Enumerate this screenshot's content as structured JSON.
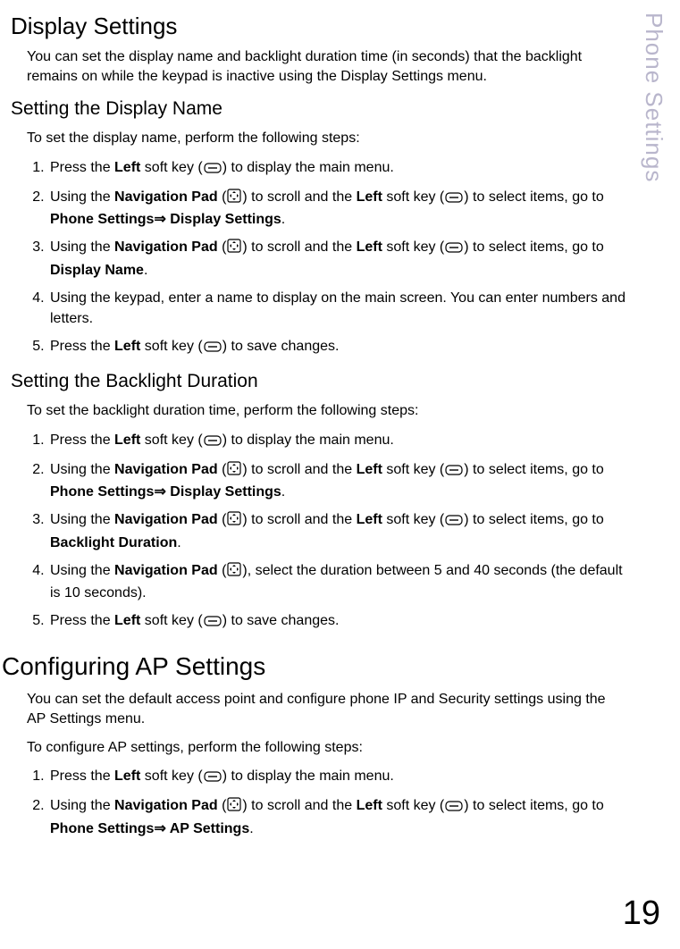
{
  "sideLabel": "Phone Settings",
  "pageNumber": "19",
  "arrow": "⇒",
  "displaySettings": {
    "heading": "Display Settings",
    "intro": "You can set the display name and backlight duration time (in seconds) that the backlight remains on while the keypad is inactive using the Display Settings menu."
  },
  "setDisplayName": {
    "heading": "Setting the Display Name",
    "intro": "To set the display name, perform the following steps:",
    "s1_a": "Press the ",
    "s1_b": "Left",
    "s1_c": " soft key (",
    "s1_d": ") to display the main menu.",
    "s2_a": "Using the ",
    "s2_b": "Navigation Pad",
    "s2_c": " (",
    "s2_d": ") to scroll and the ",
    "s2_e": "Left",
    "s2_f": " soft key (",
    "s2_g": ") to select items, go to ",
    "s2_h": "Phone Settings",
    "s2_i": " Display Settings",
    "s2_j": ".",
    "s3_a": "Using the ",
    "s3_b": "Navigation Pad",
    "s3_c": " (",
    "s3_d": ") to scroll and the ",
    "s3_e": "Left",
    "s3_f": " soft key (",
    "s3_g": ") to select items, go to ",
    "s3_h": "Display Name",
    "s3_i": ".",
    "s4": "Using the keypad, enter a name to display on the main screen. You can enter numbers and letters.",
    "s5_a": "Press the ",
    "s5_b": "Left",
    "s5_c": " soft key (",
    "s5_d": ") to save changes."
  },
  "setBacklight": {
    "heading": "Setting the Backlight Duration",
    "intro": "To set the backlight duration time, perform the following steps:",
    "s1_a": "Press the ",
    "s1_b": "Left",
    "s1_c": " soft key (",
    "s1_d": ") to display the main menu.",
    "s2_a": "Using the ",
    "s2_b": "Navigation Pad",
    "s2_c": " (",
    "s2_d": ") to scroll and the ",
    "s2_e": "Left",
    "s2_f": " soft key (",
    "s2_g": ") to select items, go to ",
    "s2_h": "Phone Settings",
    "s2_i": " Display Settings",
    "s2_j": ".",
    "s3_a": "Using the ",
    "s3_b": "Navigation Pad",
    "s3_c": " (",
    "s3_d": ") to scroll and the ",
    "s3_e": "Left",
    "s3_f": " soft key (",
    "s3_g": ") to select items, go to ",
    "s3_h": "Backlight Duration",
    "s3_i": ".",
    "s4_a": "Using the ",
    "s4_b": "Navigation Pad",
    "s4_c": " (",
    "s4_d": "), select the duration between 5 and 40 seconds (the default is 10 seconds).",
    "s5_a": "Press the ",
    "s5_b": "Left",
    "s5_c": " soft key (",
    "s5_d": ") to save changes."
  },
  "apSettings": {
    "heading": "Configuring AP Settings",
    "intro": "You can set the default access point and configure phone IP and Security settings using the AP Settings menu.",
    "lead": "To configure AP settings, perform the following steps:",
    "s1_a": "Press the ",
    "s1_b": "Left",
    "s1_c": " soft key (",
    "s1_d": ") to display the main menu.",
    "s2_a": "Using the ",
    "s2_b": "Navigation Pad",
    "s2_c": " (",
    "s2_d": ") to scroll and the ",
    "s2_e": "Left",
    "s2_f": " soft key (",
    "s2_g": ") to select items, go to ",
    "s2_h": "Phone Settings",
    "s2_i": " AP Settings",
    "s2_j": "."
  }
}
